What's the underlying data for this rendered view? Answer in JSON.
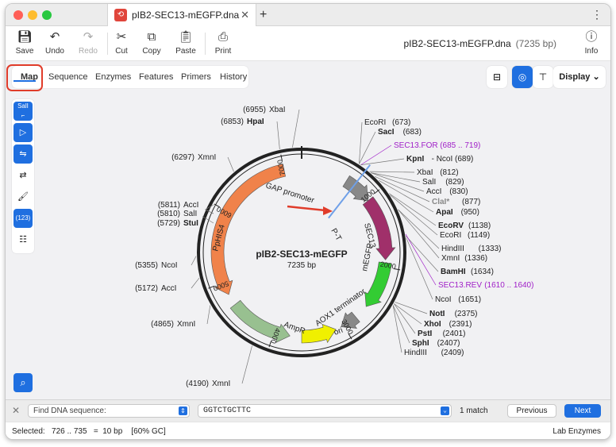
{
  "titlebar": {
    "tab_title": "pIB2-SEC13-mEGFP.dna",
    "close_glyph": "✕",
    "newtab_glyph": "+",
    "menu_glyph": "⋮"
  },
  "toolbar": {
    "save": "Save",
    "undo": "Undo",
    "redo": "Redo",
    "cut": "Cut",
    "copy": "Copy",
    "paste": "Paste",
    "print": "Print",
    "info": "Info",
    "doc_title": "pIB2-SEC13-mEGFP.dna",
    "doc_length": "(7235 bp)"
  },
  "view_tabs": [
    "Map",
    "Sequence",
    "Enzymes",
    "Features",
    "Primers",
    "History"
  ],
  "display_label": "Display",
  "sidebar": {
    "sall": "SalI",
    "count": "(123)"
  },
  "map": {
    "name": "pIB2-SEC13-mEGFP",
    "length": "7235 bp",
    "ticks": [
      {
        "label": "1000"
      },
      {
        "label": "2000"
      },
      {
        "label": "3000"
      },
      {
        "label": "4000"
      },
      {
        "label": "5000"
      },
      {
        "label": "6000"
      },
      {
        "label": "7000"
      }
    ],
    "features": [
      {
        "name": "GAP promoter"
      },
      {
        "name": "SEC13"
      },
      {
        "name": "mEGFP"
      },
      {
        "name": "AOX1 terminator"
      },
      {
        "name": "ori"
      },
      {
        "name": "AmpR"
      },
      {
        "name": "PpHIS4"
      },
      {
        "name": "P-T"
      }
    ],
    "left_labels": [
      {
        "pos": "(6955)",
        "name": "XbaI",
        "bold": false
      },
      {
        "pos": "(6853)",
        "name": "HpaI",
        "bold": true
      },
      {
        "pos": "(6297)",
        "name": "XmnI",
        "bold": false
      },
      {
        "pos": "(5811)",
        "name": "AccI",
        "bold": false
      },
      {
        "pos": "(5810)",
        "name": "SalI",
        "bold": false
      },
      {
        "pos": "(5729)",
        "name": "StuI",
        "bold": true
      },
      {
        "pos": "(5355)",
        "name": "NcoI",
        "bold": false
      },
      {
        "pos": "(5172)",
        "name": "AccI",
        "bold": false
      },
      {
        "pos": "(4865)",
        "name": "XmnI",
        "bold": false
      },
      {
        "pos": "(4190)",
        "name": "XmnI",
        "bold": false
      }
    ],
    "right_labels": [
      {
        "name": "EcoRI",
        "pos": "(673)",
        "bold": false,
        "color": "#222222"
      },
      {
        "name": "SacI",
        "pos": "(683)",
        "bold": true,
        "color": "#222222"
      },
      {
        "name": "SEC13.FOR",
        "pos": "(685 .. 719)",
        "bold": false,
        "color": "#a020c8"
      },
      {
        "name": "KpnI",
        "pos": "- NcoI  (689)",
        "bold": true,
        "color": "#222222"
      },
      {
        "name": "XbaI",
        "pos": "(812)",
        "bold": false,
        "color": "#222222"
      },
      {
        "name": "SalI",
        "pos": "(829)",
        "bold": false,
        "color": "#222222"
      },
      {
        "name": "AccI",
        "pos": "(830)",
        "bold": false,
        "color": "#222222"
      },
      {
        "name": "ClaI*",
        "pos": "(877)",
        "bold": true,
        "color": "#888888"
      },
      {
        "name": "ApaI",
        "pos": "(950)",
        "bold": true,
        "color": "#222222"
      },
      {
        "name": "EcoRV",
        "pos": "(1138)",
        "bold": true,
        "color": "#222222"
      },
      {
        "name": "EcoRI",
        "pos": "(1149)",
        "bold": false,
        "color": "#222222"
      },
      {
        "name": "HindIII",
        "pos": "(1333)",
        "bold": false,
        "color": "#222222"
      },
      {
        "name": "XmnI",
        "pos": "(1336)",
        "bold": false,
        "color": "#222222"
      },
      {
        "name": "BamHI",
        "pos": "(1634)",
        "bold": true,
        "color": "#222222"
      },
      {
        "name": "SEC13.REV",
        "pos": "(1610 .. 1640)",
        "bold": false,
        "color": "#a020c8"
      },
      {
        "name": "NcoI",
        "pos": "(1651)",
        "bold": false,
        "color": "#222222"
      },
      {
        "name": "NotI",
        "pos": "(2375)",
        "bold": true,
        "color": "#222222"
      },
      {
        "name": "XhoI",
        "pos": "(2391)",
        "bold": true,
        "color": "#222222"
      },
      {
        "name": "PstI",
        "pos": "(2401)",
        "bold": true,
        "color": "#222222"
      },
      {
        "name": "SphI",
        "pos": "(2407)",
        "bold": true,
        "color": "#222222"
      },
      {
        "name": "HindIII",
        "pos": "(2409)",
        "bold": false,
        "color": "#222222"
      }
    ]
  },
  "findbar": {
    "placeholder": "Find DNA sequence:",
    "query": "GGTCTGCTTC",
    "match": "1 match",
    "previous": "Previous",
    "next": "Next"
  },
  "status": {
    "selection": "Selected:   726 .. 735   =  10 bp    [60% GC]",
    "enzymes": "Lab Enzymes"
  },
  "colors": {
    "accent": "#1f6fe0",
    "highlight": "#e03c2a",
    "primer": "#a020c8",
    "ppHIS4": "#f0824a",
    "ampR": "#98c090",
    "sec13": "#a0306a",
    "mEGFP": "#33cc33",
    "ori": "#f0f000",
    "gap": "#888888",
    "aox1": "#888888"
  }
}
